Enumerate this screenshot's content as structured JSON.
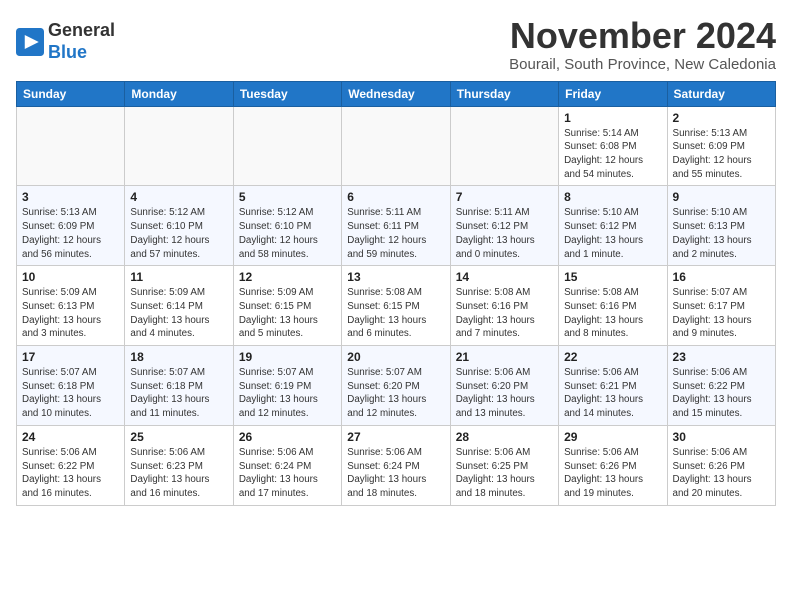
{
  "header": {
    "logo_line1": "General",
    "logo_line2": "Blue",
    "title": "November 2024",
    "subtitle": "Bourail, South Province, New Caledonia"
  },
  "days_of_week": [
    "Sunday",
    "Monday",
    "Tuesday",
    "Wednesday",
    "Thursday",
    "Friday",
    "Saturday"
  ],
  "weeks": [
    [
      {
        "day": "",
        "empty": true
      },
      {
        "day": "",
        "empty": true
      },
      {
        "day": "",
        "empty": true
      },
      {
        "day": "",
        "empty": true
      },
      {
        "day": "",
        "empty": true
      },
      {
        "day": "1",
        "detail": "Sunrise: 5:14 AM\nSunset: 6:08 PM\nDaylight: 12 hours and 54 minutes."
      },
      {
        "day": "2",
        "detail": "Sunrise: 5:13 AM\nSunset: 6:09 PM\nDaylight: 12 hours and 55 minutes."
      }
    ],
    [
      {
        "day": "3",
        "detail": "Sunrise: 5:13 AM\nSunset: 6:09 PM\nDaylight: 12 hours and 56 minutes."
      },
      {
        "day": "4",
        "detail": "Sunrise: 5:12 AM\nSunset: 6:10 PM\nDaylight: 12 hours and 57 minutes."
      },
      {
        "day": "5",
        "detail": "Sunrise: 5:12 AM\nSunset: 6:10 PM\nDaylight: 12 hours and 58 minutes."
      },
      {
        "day": "6",
        "detail": "Sunrise: 5:11 AM\nSunset: 6:11 PM\nDaylight: 12 hours and 59 minutes."
      },
      {
        "day": "7",
        "detail": "Sunrise: 5:11 AM\nSunset: 6:12 PM\nDaylight: 13 hours and 0 minutes."
      },
      {
        "day": "8",
        "detail": "Sunrise: 5:10 AM\nSunset: 6:12 PM\nDaylight: 13 hours and 1 minute."
      },
      {
        "day": "9",
        "detail": "Sunrise: 5:10 AM\nSunset: 6:13 PM\nDaylight: 13 hours and 2 minutes."
      }
    ],
    [
      {
        "day": "10",
        "detail": "Sunrise: 5:09 AM\nSunset: 6:13 PM\nDaylight: 13 hours and 3 minutes."
      },
      {
        "day": "11",
        "detail": "Sunrise: 5:09 AM\nSunset: 6:14 PM\nDaylight: 13 hours and 4 minutes."
      },
      {
        "day": "12",
        "detail": "Sunrise: 5:09 AM\nSunset: 6:15 PM\nDaylight: 13 hours and 5 minutes."
      },
      {
        "day": "13",
        "detail": "Sunrise: 5:08 AM\nSunset: 6:15 PM\nDaylight: 13 hours and 6 minutes."
      },
      {
        "day": "14",
        "detail": "Sunrise: 5:08 AM\nSunset: 6:16 PM\nDaylight: 13 hours and 7 minutes."
      },
      {
        "day": "15",
        "detail": "Sunrise: 5:08 AM\nSunset: 6:16 PM\nDaylight: 13 hours and 8 minutes."
      },
      {
        "day": "16",
        "detail": "Sunrise: 5:07 AM\nSunset: 6:17 PM\nDaylight: 13 hours and 9 minutes."
      }
    ],
    [
      {
        "day": "17",
        "detail": "Sunrise: 5:07 AM\nSunset: 6:18 PM\nDaylight: 13 hours and 10 minutes."
      },
      {
        "day": "18",
        "detail": "Sunrise: 5:07 AM\nSunset: 6:18 PM\nDaylight: 13 hours and 11 minutes."
      },
      {
        "day": "19",
        "detail": "Sunrise: 5:07 AM\nSunset: 6:19 PM\nDaylight: 13 hours and 12 minutes."
      },
      {
        "day": "20",
        "detail": "Sunrise: 5:07 AM\nSunset: 6:20 PM\nDaylight: 13 hours and 12 minutes."
      },
      {
        "day": "21",
        "detail": "Sunrise: 5:06 AM\nSunset: 6:20 PM\nDaylight: 13 hours and 13 minutes."
      },
      {
        "day": "22",
        "detail": "Sunrise: 5:06 AM\nSunset: 6:21 PM\nDaylight: 13 hours and 14 minutes."
      },
      {
        "day": "23",
        "detail": "Sunrise: 5:06 AM\nSunset: 6:22 PM\nDaylight: 13 hours and 15 minutes."
      }
    ],
    [
      {
        "day": "24",
        "detail": "Sunrise: 5:06 AM\nSunset: 6:22 PM\nDaylight: 13 hours and 16 minutes."
      },
      {
        "day": "25",
        "detail": "Sunrise: 5:06 AM\nSunset: 6:23 PM\nDaylight: 13 hours and 16 minutes."
      },
      {
        "day": "26",
        "detail": "Sunrise: 5:06 AM\nSunset: 6:24 PM\nDaylight: 13 hours and 17 minutes."
      },
      {
        "day": "27",
        "detail": "Sunrise: 5:06 AM\nSunset: 6:24 PM\nDaylight: 13 hours and 18 minutes."
      },
      {
        "day": "28",
        "detail": "Sunrise: 5:06 AM\nSunset: 6:25 PM\nDaylight: 13 hours and 18 minutes."
      },
      {
        "day": "29",
        "detail": "Sunrise: 5:06 AM\nSunset: 6:26 PM\nDaylight: 13 hours and 19 minutes."
      },
      {
        "day": "30",
        "detail": "Sunrise: 5:06 AM\nSunset: 6:26 PM\nDaylight: 13 hours and 20 minutes."
      }
    ]
  ]
}
